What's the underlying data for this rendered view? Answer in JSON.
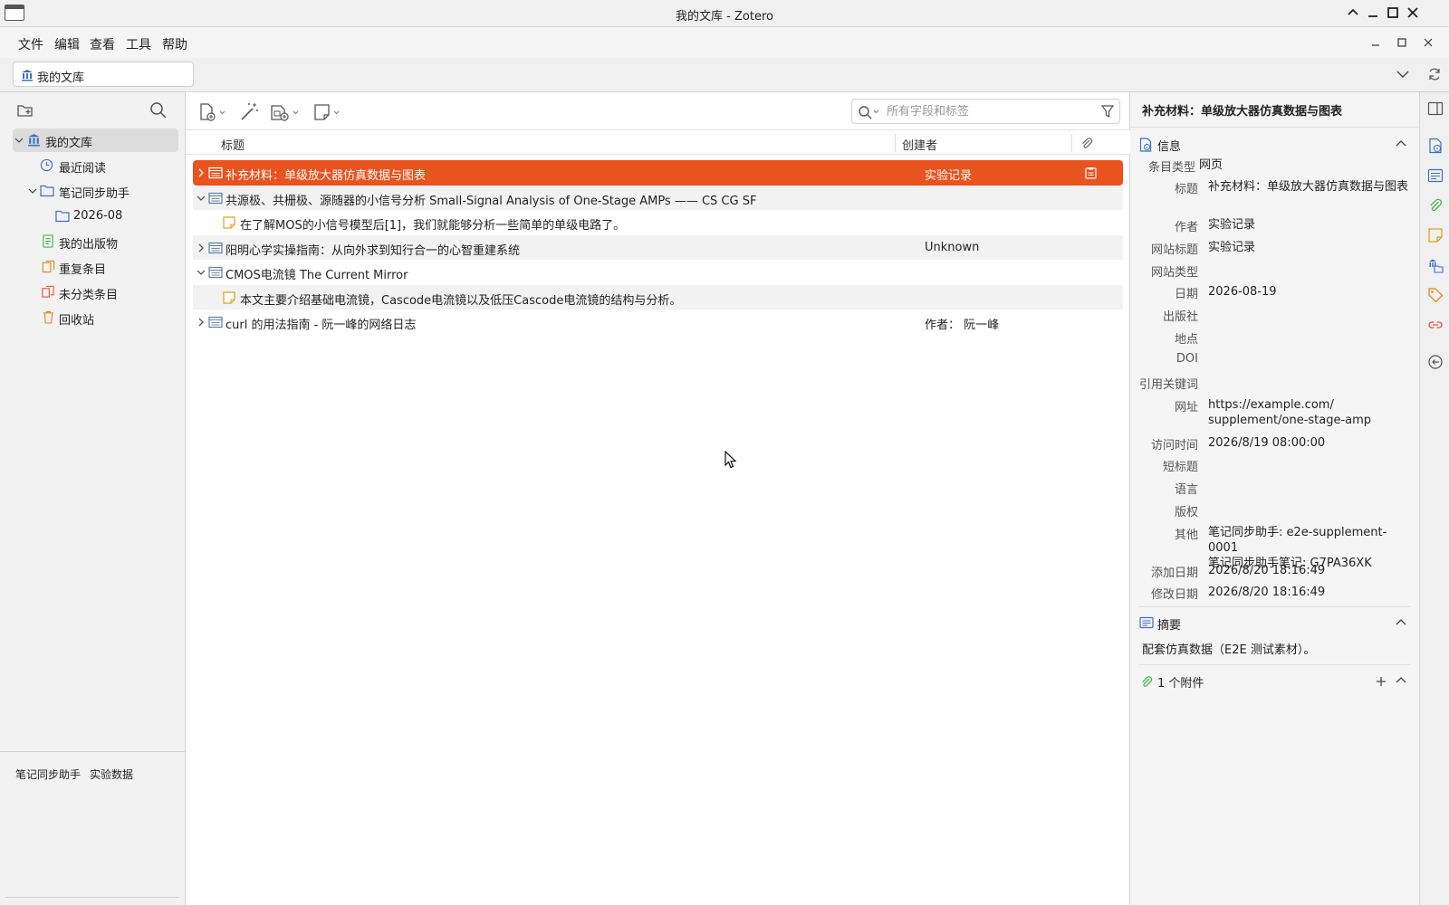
{
  "window": {
    "title": "我的文库 - Zotero"
  },
  "menu": [
    "文件",
    "编辑",
    "查看",
    "工具",
    "帮助"
  ],
  "tab": {
    "label": "我的文库"
  },
  "collections": [
    {
      "label": "我的文库",
      "icon": "library-icon",
      "selected": true
    },
    {
      "label": "最近阅读",
      "icon": "clock-icon"
    },
    {
      "label": "笔记同步助手",
      "icon": "folder-icon"
    },
    {
      "label": "2026-08",
      "icon": "folder-icon"
    },
    {
      "label": "我的出版物",
      "icon": "publications-icon"
    },
    {
      "label": "重复条目",
      "icon": "duplicate-icon"
    },
    {
      "label": "未分类条目",
      "icon": "unfiled-icon"
    },
    {
      "label": "回收站",
      "icon": "trash-icon"
    }
  ],
  "tags": [
    "笔记同步助手",
    "实验数据"
  ],
  "search": {
    "placeholder": "所有字段和标签"
  },
  "columns": {
    "title": "标题",
    "creator": "创建者"
  },
  "items": [
    {
      "title": "补充材料：单级放大器仿真数据与图表",
      "creator": "实验记录",
      "type": "webpage",
      "twisty": "collapsed",
      "selected": true,
      "attachment": true
    },
    {
      "title": "共源极、共栅极、源随器的小信号分析 Small-Signal Analysis of One-Stage AMPs —— CS CG SF",
      "creator": "",
      "type": "webpage",
      "twisty": "expanded"
    },
    {
      "title": "在了解MOS的小信号模型后[1]，我们就能够分析一些简单的单级电路了。",
      "creator": "",
      "type": "note",
      "child": true
    },
    {
      "title": "阳明心学实操指南：从向外求到知行合一的心智重建系统",
      "creator": "Unknown",
      "type": "webpage",
      "twisty": "collapsed"
    },
    {
      "title": "CMOS电流镜 The Current Mirror",
      "creator": "",
      "type": "webpage",
      "twisty": "expanded"
    },
    {
      "title": "本文主要介绍基础电流镜，Cascode电流镜以及低压Cascode电流镜的结构与分析。",
      "creator": "",
      "type": "note",
      "child": true
    },
    {
      "title": "curl 的用法指南 - 阮一峰的网络日志",
      "creator": "作者： 阮一峰",
      "type": "webpage",
      "twisty": "collapsed"
    }
  ],
  "details": {
    "header_title": "补充材料：单级放大器仿真数据与图表",
    "info_section": "信息",
    "fields": [
      {
        "label": "条目类型",
        "value": "网页"
      },
      {
        "label": "标题",
        "value": "补充材料：单级放大器仿真数据与图表"
      },
      {
        "label": "作者",
        "value": "实验记录"
      },
      {
        "label": "网站标题",
        "value": "实验记录"
      },
      {
        "label": "网站类型",
        "value": ""
      },
      {
        "label": "日期",
        "value": "2026-08-19"
      },
      {
        "label": "出版社",
        "value": ""
      },
      {
        "label": "地点",
        "value": ""
      },
      {
        "label": "DOI",
        "value": ""
      },
      {
        "label": "引用关键词",
        "value": ""
      },
      {
        "label": "网址",
        "value": "https://example.com/\nsupplement/one-stage-amp"
      },
      {
        "label": "访问时间",
        "value": "2026/8/19 08:00:00"
      },
      {
        "label": "短标题",
        "value": ""
      },
      {
        "label": "语言",
        "value": ""
      },
      {
        "label": "版权",
        "value": ""
      },
      {
        "label": "其他",
        "value": "笔记同步助手: e2e-supplement-0001\n笔记同步助手笔记: G7PA36XK"
      },
      {
        "label": "添加日期",
        "value": "2026/8/20 18:16:49"
      },
      {
        "label": "修改日期",
        "value": "2026/8/20 18:16:49"
      }
    ],
    "abstract_section": "摘要",
    "abstract": "配套仿真数据（E2E 测试素材）。",
    "attachments_section": "1 个附件"
  },
  "colors": {
    "accent": "#e9531f",
    "selected_row_text": "#ffffff"
  }
}
